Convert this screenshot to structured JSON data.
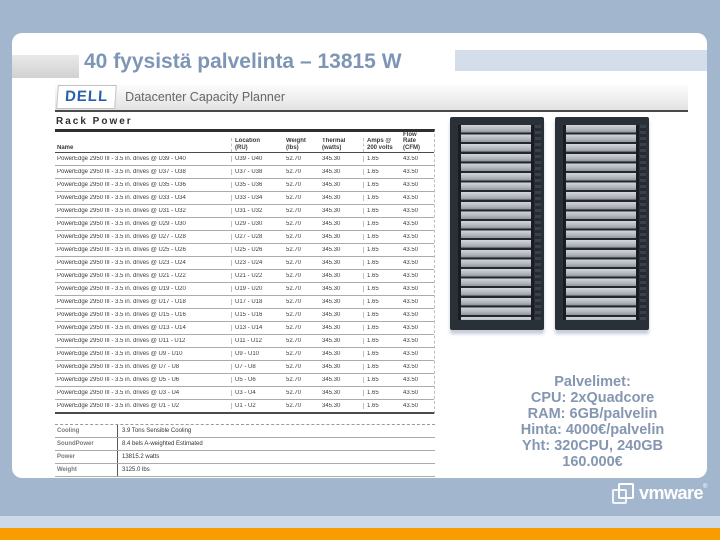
{
  "slide": {
    "title": "40 fyysistä palvelinta – 13815 W",
    "specs_lines": [
      "Palvelimet:",
      "CPU: 2xQuadcore",
      "RAM: 6GB/palvelin",
      "Hinta: 4000€/palvelin",
      "Yht: 320CPU, 240GB",
      "160.000€"
    ]
  },
  "planner": {
    "brand": "DELL",
    "app_title": "Datacenter Capacity Planner",
    "section_title": "Rack Power",
    "table": {
      "headers": {
        "name": "Name",
        "location": "Location\n(RU)",
        "weight": "Weight\n(lbs)",
        "thermal": "Thermal\n(watts)",
        "amps": "Amps @\n200 volts",
        "flow": "Flow\nRate (CFM)"
      },
      "rows": [
        {
          "name": "PowerEdge 2950 III - 3.5 in. drives @ U39 - U40",
          "location": "U39 - U40",
          "weight": "52.70",
          "thermal": "345.30",
          "amps": "1.65",
          "flow": "43.50"
        },
        {
          "name": "PowerEdge 2950 III - 3.5 in. drives @ U37 - U38",
          "location": "U37 - U38",
          "weight": "52.70",
          "thermal": "345.30",
          "amps": "1.65",
          "flow": "43.50"
        },
        {
          "name": "PowerEdge 2950 III - 3.5 in. drives @ U35 - U36",
          "location": "U35 - U36",
          "weight": "52.70",
          "thermal": "345.30",
          "amps": "1.65",
          "flow": "43.50"
        },
        {
          "name": "PowerEdge 2950 III - 3.5 in. drives @ U33 - U34",
          "location": "U33 - U34",
          "weight": "52.70",
          "thermal": "345.30",
          "amps": "1.65",
          "flow": "43.50"
        },
        {
          "name": "PowerEdge 2950 III - 3.5 in. drives @ U31 - U32",
          "location": "U31 - U32",
          "weight": "52.70",
          "thermal": "345.30",
          "amps": "1.65",
          "flow": "43.50"
        },
        {
          "name": "PowerEdge 2950 III - 3.5 in. drives @ U29 - U30",
          "location": "U29 - U30",
          "weight": "52.70",
          "thermal": "345.30",
          "amps": "1.65",
          "flow": "43.50"
        },
        {
          "name": "PowerEdge 2950 III - 3.5 in. drives @ U27 - U28",
          "location": "U27 - U28",
          "weight": "52.70",
          "thermal": "345.30",
          "amps": "1.65",
          "flow": "43.50"
        },
        {
          "name": "PowerEdge 2950 III - 3.5 in. drives @ U25 - U26",
          "location": "U25 - U26",
          "weight": "52.70",
          "thermal": "345.30",
          "amps": "1.65",
          "flow": "43.50"
        },
        {
          "name": "PowerEdge 2950 III - 3.5 in. drives @ U23 - U24",
          "location": "U23 - U24",
          "weight": "52.70",
          "thermal": "345.30",
          "amps": "1.65",
          "flow": "43.50"
        },
        {
          "name": "PowerEdge 2950 III - 3.5 in. drives @ U21 - U22",
          "location": "U21 - U22",
          "weight": "52.70",
          "thermal": "345.30",
          "amps": "1.65",
          "flow": "43.50"
        },
        {
          "name": "PowerEdge 2950 III - 3.5 in. drives @ U19 - U20",
          "location": "U19 - U20",
          "weight": "52.70",
          "thermal": "345.30",
          "amps": "1.65",
          "flow": "43.50"
        },
        {
          "name": "PowerEdge 2950 III - 3.5 in. drives @ U17 - U18",
          "location": "U17 - U18",
          "weight": "52.70",
          "thermal": "345.30",
          "amps": "1.65",
          "flow": "43.50"
        },
        {
          "name": "PowerEdge 2950 III - 3.5 in. drives @ U15 - U16",
          "location": "U15 - U16",
          "weight": "52.70",
          "thermal": "345.30",
          "amps": "1.65",
          "flow": "43.50"
        },
        {
          "name": "PowerEdge 2950 III - 3.5 in. drives @ U13 - U14",
          "location": "U13 - U14",
          "weight": "52.70",
          "thermal": "345.30",
          "amps": "1.65",
          "flow": "43.50"
        },
        {
          "name": "PowerEdge 2950 III - 3.5 in. drives @ U11 - U12",
          "location": "U11 - U12",
          "weight": "52.70",
          "thermal": "345.30",
          "amps": "1.65",
          "flow": "43.50"
        },
        {
          "name": "PowerEdge 2950 III - 3.5 in. drives @ U9 - U10",
          "location": "U9 - U10",
          "weight": "52.70",
          "thermal": "345.30",
          "amps": "1.65",
          "flow": "43.50"
        },
        {
          "name": "PowerEdge 2950 III - 3.5 in. drives @ U7 - U8",
          "location": "U7 - U8",
          "weight": "52.70",
          "thermal": "345.30",
          "amps": "1.65",
          "flow": "43.50"
        },
        {
          "name": "PowerEdge 2950 III - 3.5 in. drives @ U5 - U6",
          "location": "U5 - U6",
          "weight": "52.70",
          "thermal": "345.30",
          "amps": "1.65",
          "flow": "43.50"
        },
        {
          "name": "PowerEdge 2950 III - 3.5 in. drives @ U3 - U4",
          "location": "U3 - U4",
          "weight": "52.70",
          "thermal": "345.30",
          "amps": "1.65",
          "flow": "43.50"
        },
        {
          "name": "PowerEdge 2950 III - 3.5 in. drives @ U1 - U2",
          "location": "U1 - U2",
          "weight": "52.70",
          "thermal": "345.30",
          "amps": "1.65",
          "flow": "43.50"
        }
      ]
    },
    "summary": [
      {
        "label": "Cooling",
        "value": "3.9 Tons Sensible Cooling"
      },
      {
        "label": "SoundPower",
        "value": "8.4 bels A-weighted Estimated"
      },
      {
        "label": "Power",
        "value": "13815.2 watts"
      },
      {
        "label": "Weight",
        "value": "3125.0 lbs"
      }
    ]
  },
  "footer": {
    "logo_text": "vmware",
    "logo_mark": "®"
  },
  "colors": {
    "frame_blue": "#a2b7ce",
    "accent_orange": "#f99c00",
    "strip_light_blue": "#ccd9e8",
    "title_text": "#7e96b6",
    "dell_blue": "#2a5fae",
    "specs_text": "#8496b0"
  }
}
